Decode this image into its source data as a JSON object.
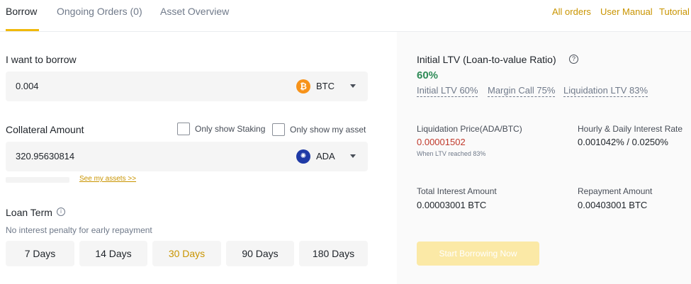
{
  "tabs": [
    {
      "label": "Borrow",
      "active": true
    },
    {
      "label": "Ongoing Orders (0)",
      "active": false
    },
    {
      "label": "Asset Overview",
      "active": false
    }
  ],
  "top_links": [
    "All orders",
    "User Manual",
    "Tutorial"
  ],
  "borrow": {
    "label": "I want to borrow",
    "value": "0.004",
    "coin": "BTC",
    "coin_icon": "bitcoin-icon"
  },
  "collateral": {
    "label": "Collateral Amount",
    "only_show_staking": "Only show Staking",
    "only_show_my_asset": "Only show my asset",
    "value": "320.95630814",
    "coin": "ADA",
    "coin_icon": "cardano-icon",
    "see_assets": "See my assets >>"
  },
  "loan_term": {
    "label": "Loan Term",
    "note": "No interest penalty for early repayment",
    "options": [
      "7 Days",
      "14 Days",
      "30 Days",
      "90 Days",
      "180 Days"
    ],
    "selected": "30 Days"
  },
  "summary": {
    "initial_ltv_title": "Initial LTV (Loan-to-value Ratio)",
    "initial_ltv_value": "60%",
    "ltv_items": [
      "Initial LTV 60%",
      "Margin Call 75%",
      "Liquidation LTV 83%"
    ],
    "liquidation_price_label": "Liquidation Price(ADA/BTC)",
    "liquidation_price_value": "0.00001502",
    "liquidation_note": "When LTV reached 83%",
    "interest_rate_label": "Hourly & Daily Interest Rate",
    "interest_rate_value": "0.001042% / 0.0250%",
    "total_interest_label": "Total Interest Amount",
    "total_interest_value": "0.00003001 BTC",
    "repayment_label": "Repayment Amount",
    "repayment_value": "0.00403001 BTC",
    "start_button": "Start Borrowing Now"
  },
  "colors": {
    "accent": "#f0b90b",
    "link": "#c99400",
    "ltv_green": "#2e8b57",
    "liquidation_red": "#c0392b"
  }
}
